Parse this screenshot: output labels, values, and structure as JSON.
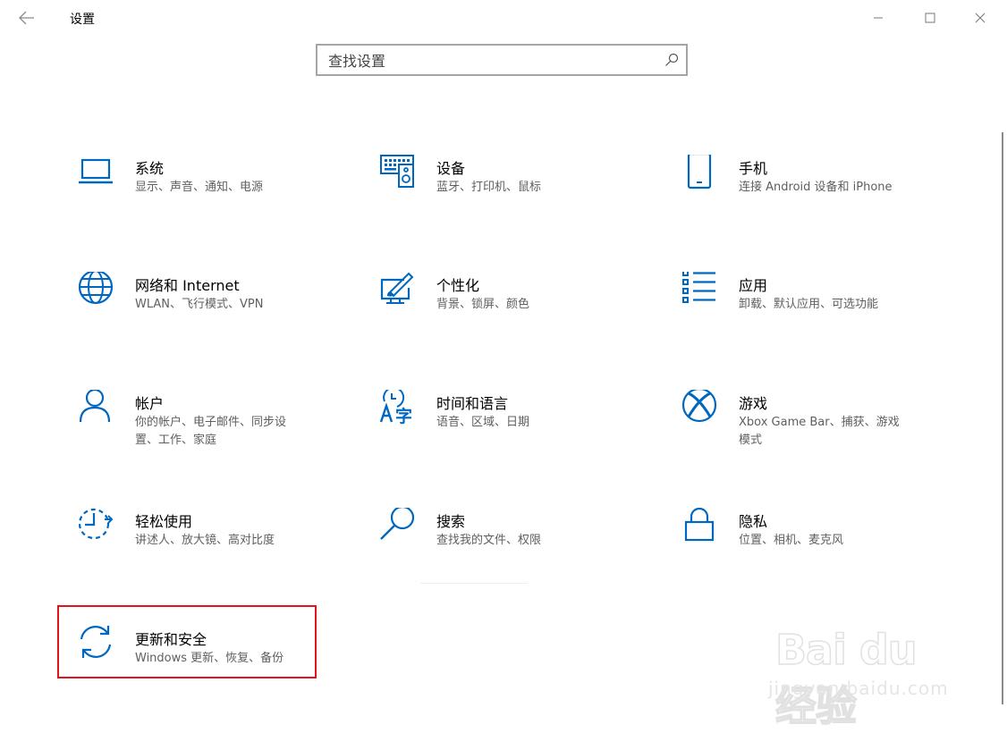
{
  "window": {
    "title": "设置"
  },
  "search": {
    "placeholder": "查找设置"
  },
  "tiles": [
    {
      "title": "系统",
      "desc": "显示、声音、通知、电源"
    },
    {
      "title": "设备",
      "desc": "蓝牙、打印机、鼠标"
    },
    {
      "title": "手机",
      "desc": "连接 Android 设备和 iPhone"
    },
    {
      "title": "网络和 Internet",
      "desc": "WLAN、飞行模式、VPN"
    },
    {
      "title": "个性化",
      "desc": "背景、锁屏、颜色"
    },
    {
      "title": "应用",
      "desc": "卸载、默认应用、可选功能"
    },
    {
      "title": "帐户",
      "desc_lines": [
        "你的帐户、电子邮件、同步设",
        "置、工作、家庭"
      ]
    },
    {
      "title": "时间和语言",
      "desc": "语音、区域、日期"
    },
    {
      "title": "游戏",
      "desc_lines": [
        "Xbox Game Bar、捕获、游戏",
        "模式"
      ]
    },
    {
      "title": "轻松使用",
      "desc": "讲述人、放大镜、高对比度"
    },
    {
      "title": "搜索",
      "desc": "查找我的文件、权限"
    },
    {
      "title": "隐私",
      "desc": "位置、相机、麦克风"
    },
    {
      "title": "更新和安全",
      "desc": "Windows 更新、恢复、备份"
    }
  ],
  "colors": {
    "accent": "#0067c0",
    "highlight_border": "#e0141a"
  },
  "watermark": {
    "logo_text": "Bai du 经验",
    "url": "jingyan.baidu.com"
  }
}
